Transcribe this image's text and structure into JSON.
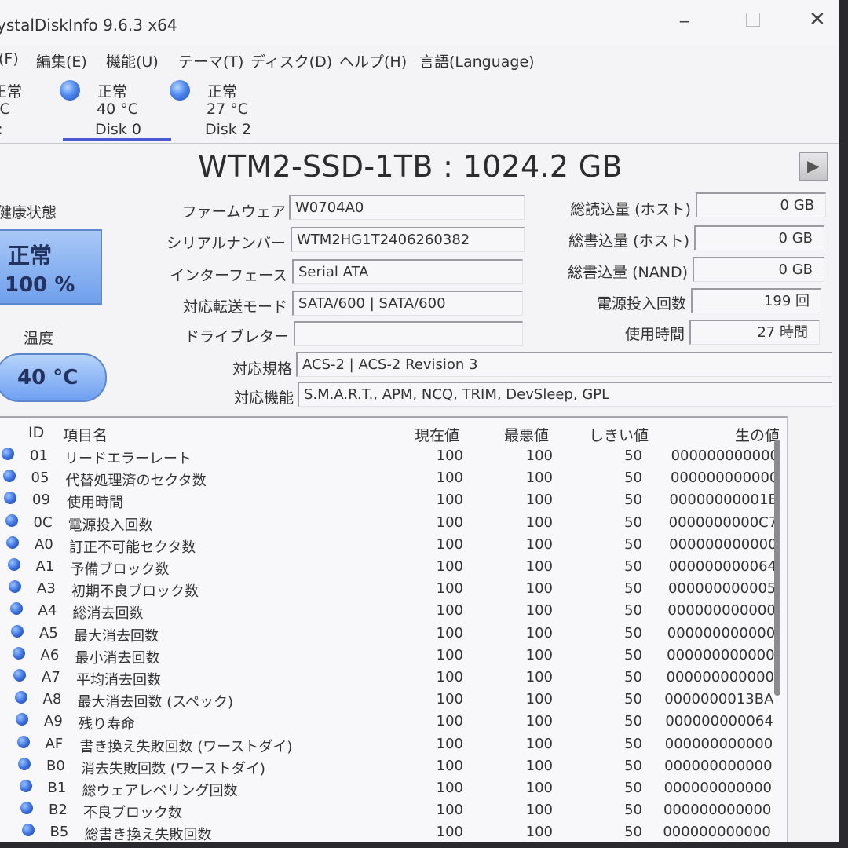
{
  "window": {
    "title": "ystalDiskInfo 9.6.3 x64",
    "min_glyph": "_",
    "max_glyph": "",
    "close_glyph": "✕"
  },
  "menu": [
    "(F)",
    "編集(E)",
    "機能(U)",
    "テーマ(T)",
    "ディスク(D)",
    "ヘルプ(H)",
    "言語(Language)"
  ],
  "disks": [
    {
      "status": "正常",
      "temp": "°C",
      "name": "C:"
    },
    {
      "status": "正常",
      "temp": "40 °C",
      "name": "Disk 0"
    },
    {
      "status": "正常",
      "temp": "27 °C",
      "name": "Disk 2"
    }
  ],
  "model": "WTM2-SSD-1TB : 1024.2 GB",
  "play_glyph": "▶",
  "health": {
    "label": "健康状態",
    "status": "正常",
    "percent": "100 %"
  },
  "temperature": {
    "label": "温度",
    "value": "40 °C"
  },
  "info_left": [
    {
      "label": "ファームウェア",
      "value": "W0704A0"
    },
    {
      "label": "シリアルナンバー",
      "value": "WTM2HG1T2406260382"
    },
    {
      "label": "インターフェース",
      "value": "Serial ATA"
    },
    {
      "label": "対応転送モード",
      "value": "SATA/600 | SATA/600"
    },
    {
      "label": "ドライブレター",
      "value": ""
    }
  ],
  "info_right": [
    {
      "label": "総読込量 (ホスト)",
      "value": "0 GB"
    },
    {
      "label": "総書込量 (ホスト)",
      "value": "0 GB"
    },
    {
      "label": "総書込量 (NAND)",
      "value": "0 GB"
    },
    {
      "label": "電源投入回数",
      "value": "199 回"
    },
    {
      "label": "使用時間",
      "value": "27 時間"
    }
  ],
  "standard": {
    "label": "対応規格",
    "value": "ACS-2 | ACS-2 Revision 3"
  },
  "features": {
    "label": "対応機能",
    "value": "S.M.A.R.T., APM, NCQ, TRIM, DevSleep, GPL"
  },
  "smart_headers": {
    "id": "ID",
    "name": "項目名",
    "current": "現在値",
    "worst": "最悪値",
    "threshold": "しきい値",
    "raw": "生の値"
  },
  "smart_rows": [
    {
      "id": "01",
      "name": "リードエラーレート",
      "current": "100",
      "worst": "100",
      "threshold": "50",
      "raw": "000000000000"
    },
    {
      "id": "05",
      "name": "代替処理済のセクタ数",
      "current": "100",
      "worst": "100",
      "threshold": "50",
      "raw": "000000000000"
    },
    {
      "id": "09",
      "name": "使用時間",
      "current": "100",
      "worst": "100",
      "threshold": "50",
      "raw": "00000000001B"
    },
    {
      "id": "0C",
      "name": "電源投入回数",
      "current": "100",
      "worst": "100",
      "threshold": "50",
      "raw": "0000000000C7"
    },
    {
      "id": "A0",
      "name": "訂正不可能セクタ数",
      "current": "100",
      "worst": "100",
      "threshold": "50",
      "raw": "000000000000"
    },
    {
      "id": "A1",
      "name": "予備ブロック数",
      "current": "100",
      "worst": "100",
      "threshold": "50",
      "raw": "000000000064"
    },
    {
      "id": "A3",
      "name": "初期不良ブロック数",
      "current": "100",
      "worst": "100",
      "threshold": "50",
      "raw": "000000000005"
    },
    {
      "id": "A4",
      "name": "総消去回数",
      "current": "100",
      "worst": "100",
      "threshold": "50",
      "raw": "000000000000"
    },
    {
      "id": "A5",
      "name": "最大消去回数",
      "current": "100",
      "worst": "100",
      "threshold": "50",
      "raw": "000000000000"
    },
    {
      "id": "A6",
      "name": "最小消去回数",
      "current": "100",
      "worst": "100",
      "threshold": "50",
      "raw": "000000000000"
    },
    {
      "id": "A7",
      "name": "平均消去回数",
      "current": "100",
      "worst": "100",
      "threshold": "50",
      "raw": "000000000000"
    },
    {
      "id": "A8",
      "name": "最大消去回数 (スペック)",
      "current": "100",
      "worst": "100",
      "threshold": "50",
      "raw": "0000000013BA"
    },
    {
      "id": "A9",
      "name": "残り寿命",
      "current": "100",
      "worst": "100",
      "threshold": "50",
      "raw": "000000000064"
    },
    {
      "id": "AF",
      "name": "書き換え失敗回数 (ワーストダイ)",
      "current": "100",
      "worst": "100",
      "threshold": "50",
      "raw": "000000000000"
    },
    {
      "id": "B0",
      "name": "消去失敗回数 (ワーストダイ)",
      "current": "100",
      "worst": "100",
      "threshold": "50",
      "raw": "000000000000"
    },
    {
      "id": "B1",
      "name": "総ウェアレベリング回数",
      "current": "100",
      "worst": "100",
      "threshold": "50",
      "raw": "000000000000"
    },
    {
      "id": "B2",
      "name": "不良ブロック数",
      "current": "100",
      "worst": "100",
      "threshold": "50",
      "raw": "000000000000"
    },
    {
      "id": "B5",
      "name": "総書き換え失敗回数",
      "current": "100",
      "worst": "100",
      "threshold": "50",
      "raw": "000000000000"
    }
  ]
}
